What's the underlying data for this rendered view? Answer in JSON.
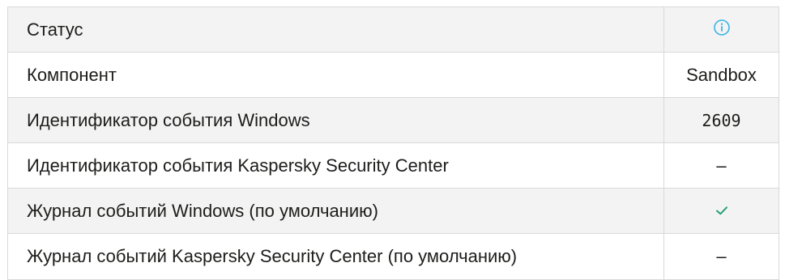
{
  "table": {
    "rows": [
      {
        "label": "Статус",
        "value": "",
        "value_icon": "info-icon"
      },
      {
        "label": "Компонент",
        "value": "Sandbox"
      },
      {
        "label": "Идентификатор события Windows",
        "value": "2609"
      },
      {
        "label": "Идентификатор события Kaspersky Security Center",
        "value": "–"
      },
      {
        "label": "Журнал событий Windows (по умолчанию)",
        "value": "",
        "value_icon": "checkmark-icon"
      },
      {
        "label": "Журнал событий Kaspersky Security Center (по умолчанию)",
        "value": "–"
      }
    ]
  },
  "colors": {
    "info_icon": "#3ab4e6",
    "check_icon": "#1f9f6f",
    "row_shade": "#f3f3f3",
    "border": "#d9d9d9"
  }
}
